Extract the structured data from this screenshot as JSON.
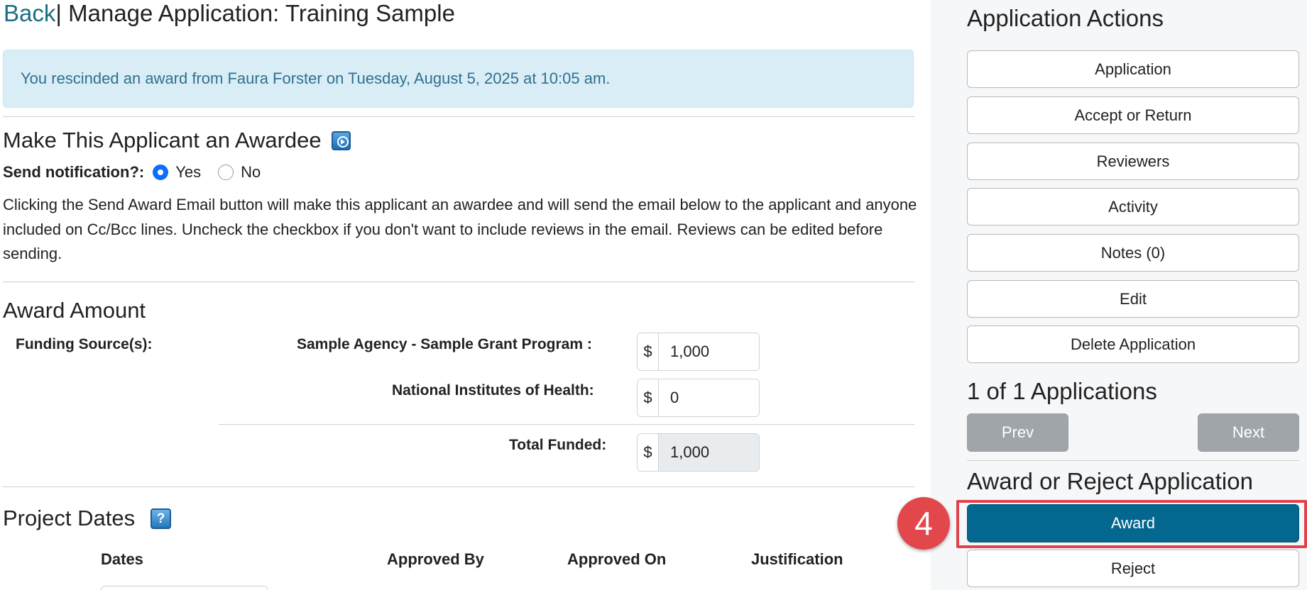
{
  "header": {
    "back_link": "Back",
    "separator": "|",
    "title": "Manage Application: Training Sample"
  },
  "alert": {
    "message": "You rescinded an award from Faura Forster on Tuesday, August 5, 2025 at 10:05 am."
  },
  "awardee_section": {
    "heading": "Make This Applicant an Awardee",
    "video_icon": "play-video-icon",
    "notification_label": "Send notification?:",
    "options": [
      {
        "label": "Yes",
        "selected": true
      },
      {
        "label": "No",
        "selected": false
      }
    ],
    "description": "Clicking the Send Award Email button will make this applicant an awardee and will send the email below to the applicant and anyone included on Cc/Bcc lines. Uncheck the checkbox if you don't want to include reviews in the email. Reviews can be edited before sending."
  },
  "award_amount": {
    "heading": "Award Amount",
    "funding_label": "Funding Source(s):",
    "currency": "$",
    "sources": [
      {
        "label": "Sample Agency - Sample Grant Program :",
        "value": "1,000"
      },
      {
        "label": "National Institutes of Health:",
        "value": "0"
      }
    ],
    "total_label": "Total Funded:",
    "total_value": "1,000"
  },
  "project_dates": {
    "heading": "Project Dates",
    "help_icon": "question-help-icon",
    "help_glyph": "?",
    "columns": [
      "Dates",
      "Approved By",
      "Approved On",
      "Justification"
    ]
  },
  "sidebar": {
    "actions_heading": "Application Actions",
    "actions": [
      "Application",
      "Accept or Return",
      "Reviewers",
      "Activity",
      "Notes (0)",
      "Edit",
      "Delete Application"
    ],
    "count_text": "1 of 1 Applications",
    "prev_label": "Prev",
    "next_label": "Next",
    "decision_heading": "Award or Reject Application",
    "award_label": "Award",
    "reject_label": "Reject"
  },
  "annotation": {
    "step_number": "4",
    "highlight_color": "#e0434a"
  },
  "colors": {
    "link": "#1b6e86",
    "award_button": "#04678f",
    "alert_bg": "#d9edf7",
    "alert_text": "#31708f",
    "nav_button": "#a0a5aa"
  }
}
